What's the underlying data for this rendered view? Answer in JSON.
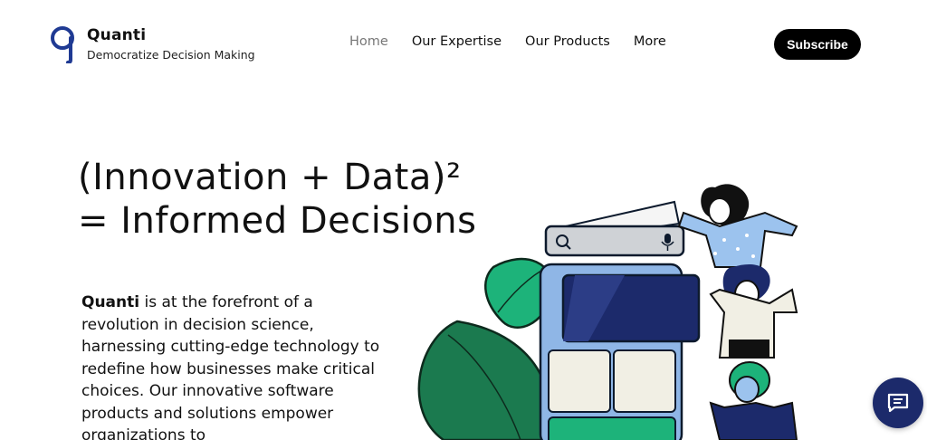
{
  "brand": {
    "name": "Quanti",
    "tagline": "Democratize Decision Making"
  },
  "nav": {
    "items": [
      {
        "label": "Home",
        "active": true
      },
      {
        "label": "Our Expertise",
        "active": false
      },
      {
        "label": "Our Products",
        "active": false
      },
      {
        "label": "More",
        "active": false
      }
    ],
    "subscribe_label": "Subscribe"
  },
  "hero": {
    "title_line1": "(Innovation + Data)²",
    "title_line2": "= Informed Decisions",
    "body_bold": "Quanti",
    "body_text": " is at the forefront of a revolution in decision science, harnessing cutting-edge technology to redefine how businesses make critical choices. Our innovative software products and solutions empower organizations to"
  },
  "colors": {
    "accent_navy": "#1c2a6b",
    "logo_blue": "#1f3a93",
    "leaf_green": "#1b8a5a",
    "phone_blue": "#8fb6e6"
  },
  "icons": {
    "logo": "quanti-q-logo",
    "chat": "chat-icon",
    "search": "search-icon",
    "mic": "mic-icon"
  }
}
